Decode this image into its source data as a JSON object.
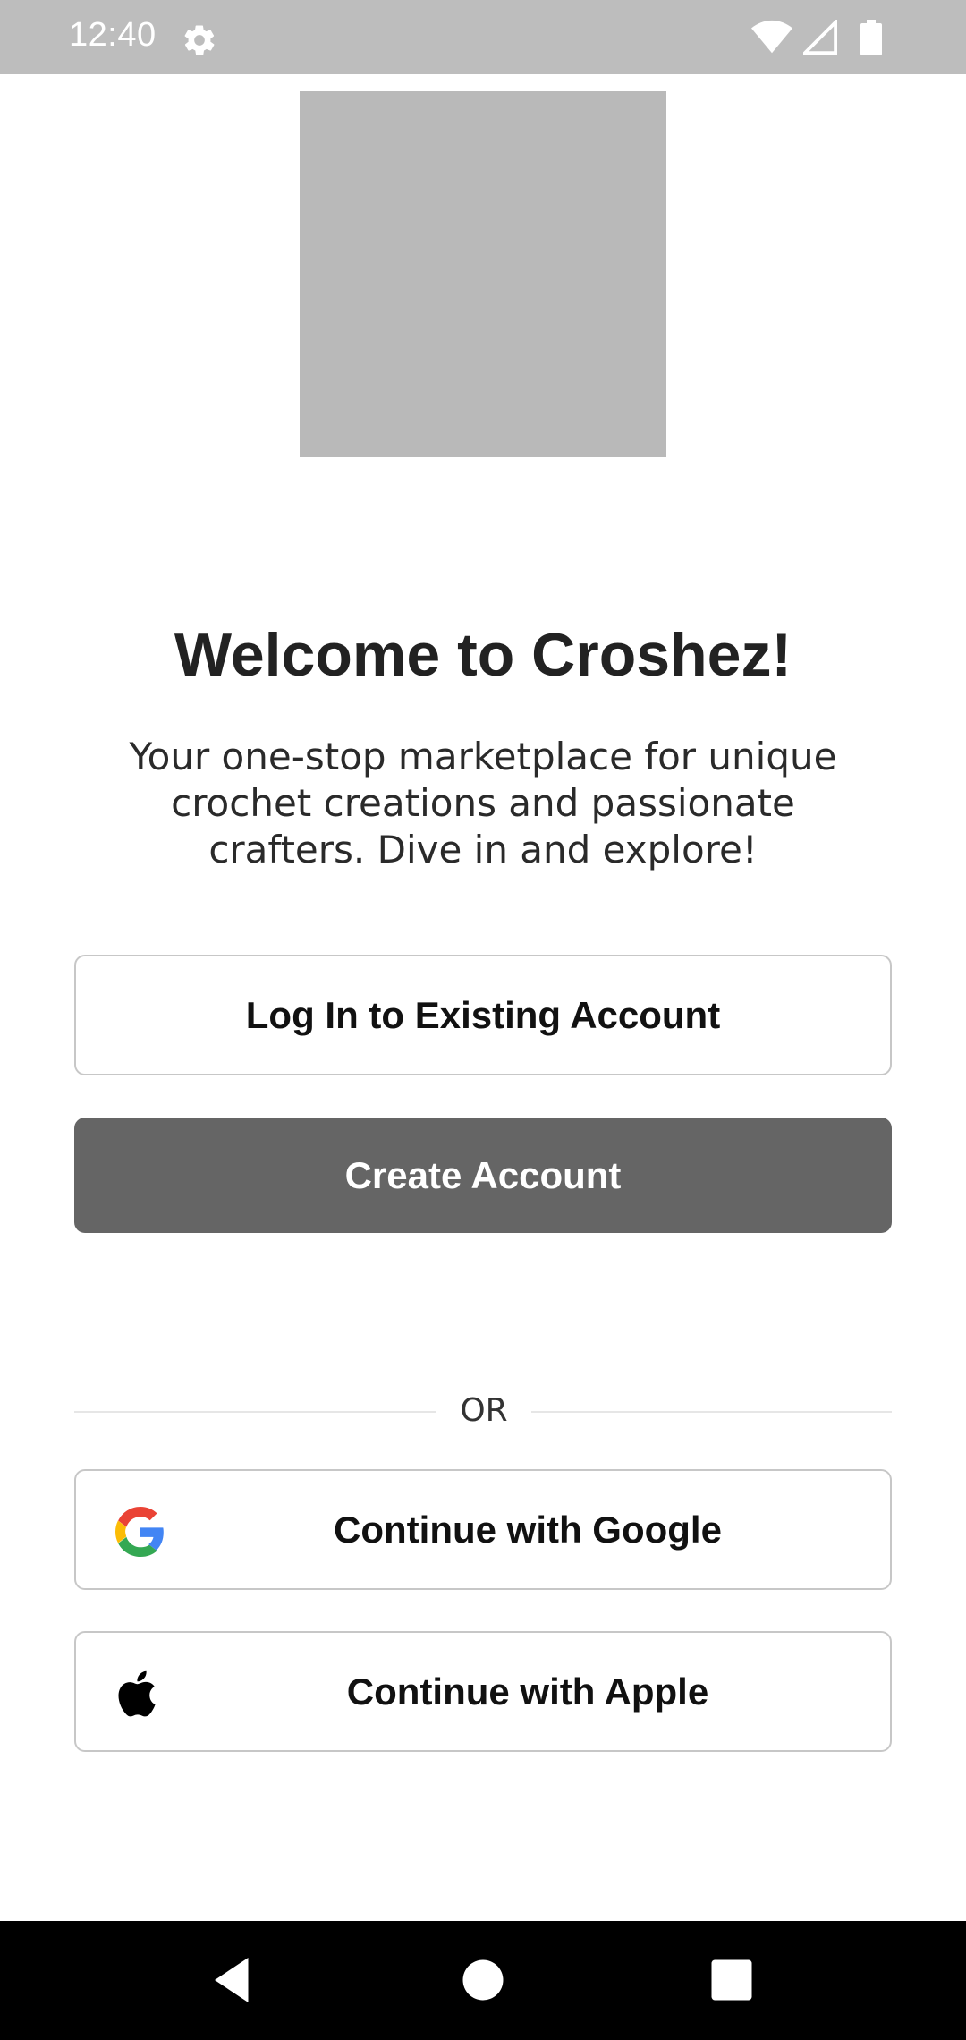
{
  "status_bar": {
    "time": "12:40",
    "icons": [
      "settings-gear-icon",
      "wifi-icon",
      "cellular-signal-icon",
      "battery-icon"
    ]
  },
  "welcome": {
    "title": "Welcome to Croshez!",
    "subtitle": "Your one-stop marketplace for unique crochet creations and passionate crafters. Dive in and explore!"
  },
  "actions": {
    "login_label": "Log In to Existing Account",
    "create_label": "Create Account"
  },
  "divider": {
    "label": "OR"
  },
  "social": {
    "google_label": "Continue with Google",
    "apple_label": "Continue with Apple"
  },
  "navigation": {
    "buttons": [
      "back-icon",
      "home-icon",
      "recents-icon"
    ]
  },
  "colors": {
    "status_bar_bg": "#bdbdbd",
    "logo_placeholder": "#b9b9b9",
    "primary_button": "#656565",
    "outline_border": "#c7c7c7",
    "nav_bar_bg": "#000000"
  }
}
